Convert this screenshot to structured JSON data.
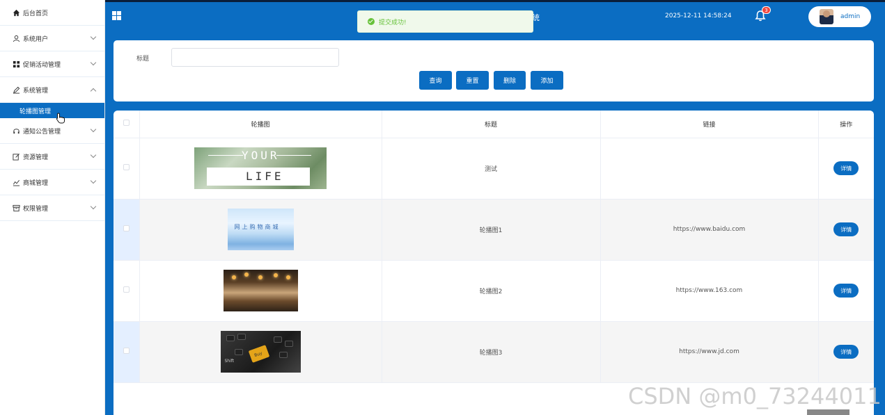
{
  "sidebar": {
    "items": [
      {
        "label": "后台首页",
        "icon": "home-icon"
      },
      {
        "label": "系统用户",
        "icon": "user-icon"
      },
      {
        "label": "促销活动管理",
        "icon": "grid-icon"
      },
      {
        "label": "系统管理",
        "icon": "pen-icon",
        "expanded": true,
        "children": [
          {
            "label": "轮播图管理",
            "active": true
          }
        ]
      },
      {
        "label": "通知公告管理",
        "icon": "headset-icon"
      },
      {
        "label": "资源管理",
        "icon": "edit-icon"
      },
      {
        "label": "商城管理",
        "icon": "chart-icon"
      },
      {
        "label": "权限管理",
        "icon": "archive-icon"
      }
    ]
  },
  "header": {
    "title_fragment": "统",
    "datetime": "2025-12-11 14:58:24",
    "notification_count": "3",
    "username": "admin"
  },
  "toast": {
    "message": "提交成功!",
    "type": "success"
  },
  "search": {
    "label": "标题",
    "value": "",
    "buttons": {
      "query": "查询",
      "reset": "重置",
      "delete": "删除",
      "add": "添加"
    }
  },
  "table": {
    "headers": {
      "image": "轮播图",
      "title": "标题",
      "link": "链接",
      "actions": "操作"
    },
    "rows": [
      {
        "image_caption": [
          "YOUR",
          "LIFE"
        ],
        "title": "测试",
        "link": "",
        "action": "详情"
      },
      {
        "image_caption": [
          "网上购物商城"
        ],
        "title": "轮播图1",
        "link": "https://www.baidu.com",
        "action": "详情"
      },
      {
        "image_caption": [],
        "title": "轮播图2",
        "link": "https://www.163.com",
        "action": "详情"
      },
      {
        "image_caption": [
          "Buy",
          "Shift"
        ],
        "title": "轮播图3",
        "link": "https://www.jd.com",
        "action": "详情"
      }
    ]
  },
  "watermark": "CSDN @m0_73244011",
  "colors": {
    "primary": "#0b6dc2",
    "success": "#67c23a",
    "badge": "#f0463e"
  }
}
